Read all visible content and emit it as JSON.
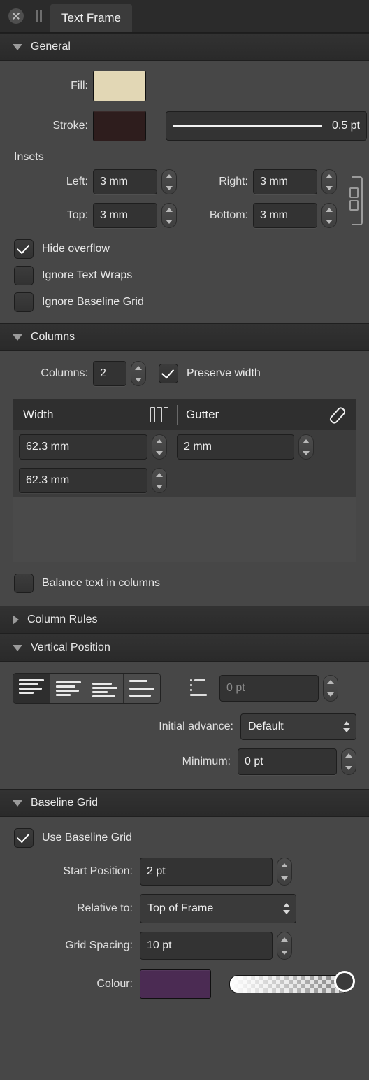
{
  "titlebar": {
    "close_icon": "close-circle-icon",
    "grip_icon": "pause-grip-icon",
    "tab_label": "Text Frame"
  },
  "sections": {
    "general": {
      "title": "General",
      "expanded": true,
      "fill_label": "Fill:",
      "fill_color": "#e2d7b5",
      "stroke_label": "Stroke:",
      "stroke_color": "#2e1d1d",
      "stroke_width": "0.5 pt",
      "insets_label": "Insets",
      "insets": [
        {
          "label": "Left:",
          "value": "3 mm"
        },
        {
          "label": "Right:",
          "value": "3 mm"
        },
        {
          "label": "Top:",
          "value": "3 mm"
        },
        {
          "label": "Bottom:",
          "value": "3 mm"
        }
      ],
      "link_icon": "link-chain-icon",
      "checkboxes": [
        {
          "label": "Hide overflow",
          "checked": true
        },
        {
          "label": "Ignore Text Wraps",
          "checked": false
        },
        {
          "label": "Ignore Baseline Grid",
          "checked": false
        }
      ]
    },
    "columns": {
      "title": "Columns",
      "expanded": true,
      "count_label": "Columns:",
      "count_value": "2",
      "preserve_label": "Preserve width",
      "preserve_checked": true,
      "table": {
        "width_header": "Width",
        "gutter_header": "Gutter",
        "columns_icon": "columns-icon",
        "edit_icon": "pencil-icon",
        "rows": [
          {
            "width": "62.3 mm",
            "gutter": "2 mm"
          },
          {
            "width": "62.3 mm",
            "gutter": ""
          }
        ]
      },
      "balance_label": "Balance text in columns",
      "balance_checked": false
    },
    "column_rules": {
      "title": "Column Rules",
      "expanded": false
    },
    "vertical_position": {
      "title": "Vertical Position",
      "expanded": true,
      "align_buttons": [
        {
          "name": "align-top",
          "selected": true
        },
        {
          "name": "align-center",
          "selected": false
        },
        {
          "name": "align-bottom",
          "selected": false
        },
        {
          "name": "align-justify",
          "selected": false
        }
      ],
      "baseline_icon": "baseline-offset-icon",
      "offset_value": "0 pt",
      "offset_is_placeholder": true,
      "initial_advance_label": "Initial advance:",
      "initial_advance_value": "Default",
      "minimum_label": "Minimum:",
      "minimum_value": "0 pt"
    },
    "baseline_grid": {
      "title": "Baseline Grid",
      "expanded": true,
      "use_label": "Use Baseline Grid",
      "use_checked": true,
      "start_label": "Start Position:",
      "start_value": "2 pt",
      "relative_label": "Relative to:",
      "relative_value": "Top of Frame",
      "spacing_label": "Grid Spacing:",
      "spacing_value": "10 pt",
      "colour_label": "Colour:",
      "colour_value": "#4b2b53",
      "opacity_percent": 100
    }
  }
}
